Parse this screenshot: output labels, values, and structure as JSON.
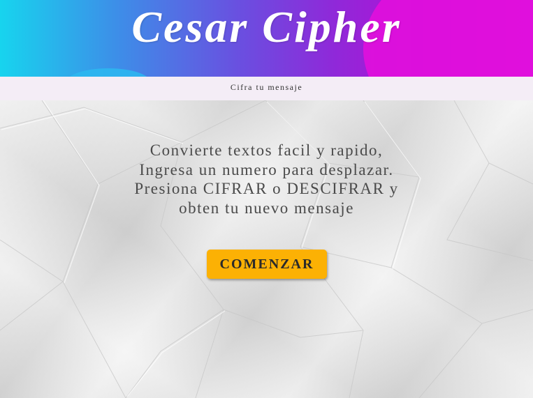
{
  "header": {
    "title": "Cesar Cipher",
    "subtitle": "Cifra tu mensaje"
  },
  "main": {
    "intro_lines": [
      "Convierte textos facil y rapido,",
      "Ingresa un numero para desplazar.",
      "Presiona CIFRAR o DESCIFRAR y",
      "obten tu nuevo mensaje"
    ],
    "start_button_label": "COMENZAR"
  },
  "colors": {
    "gradient_start": "#17d4ee",
    "gradient_end": "#d80ad9",
    "subbar_background": "#f4edf6",
    "button_background": "#fcb104",
    "intro_text": "#4a4a4a"
  }
}
